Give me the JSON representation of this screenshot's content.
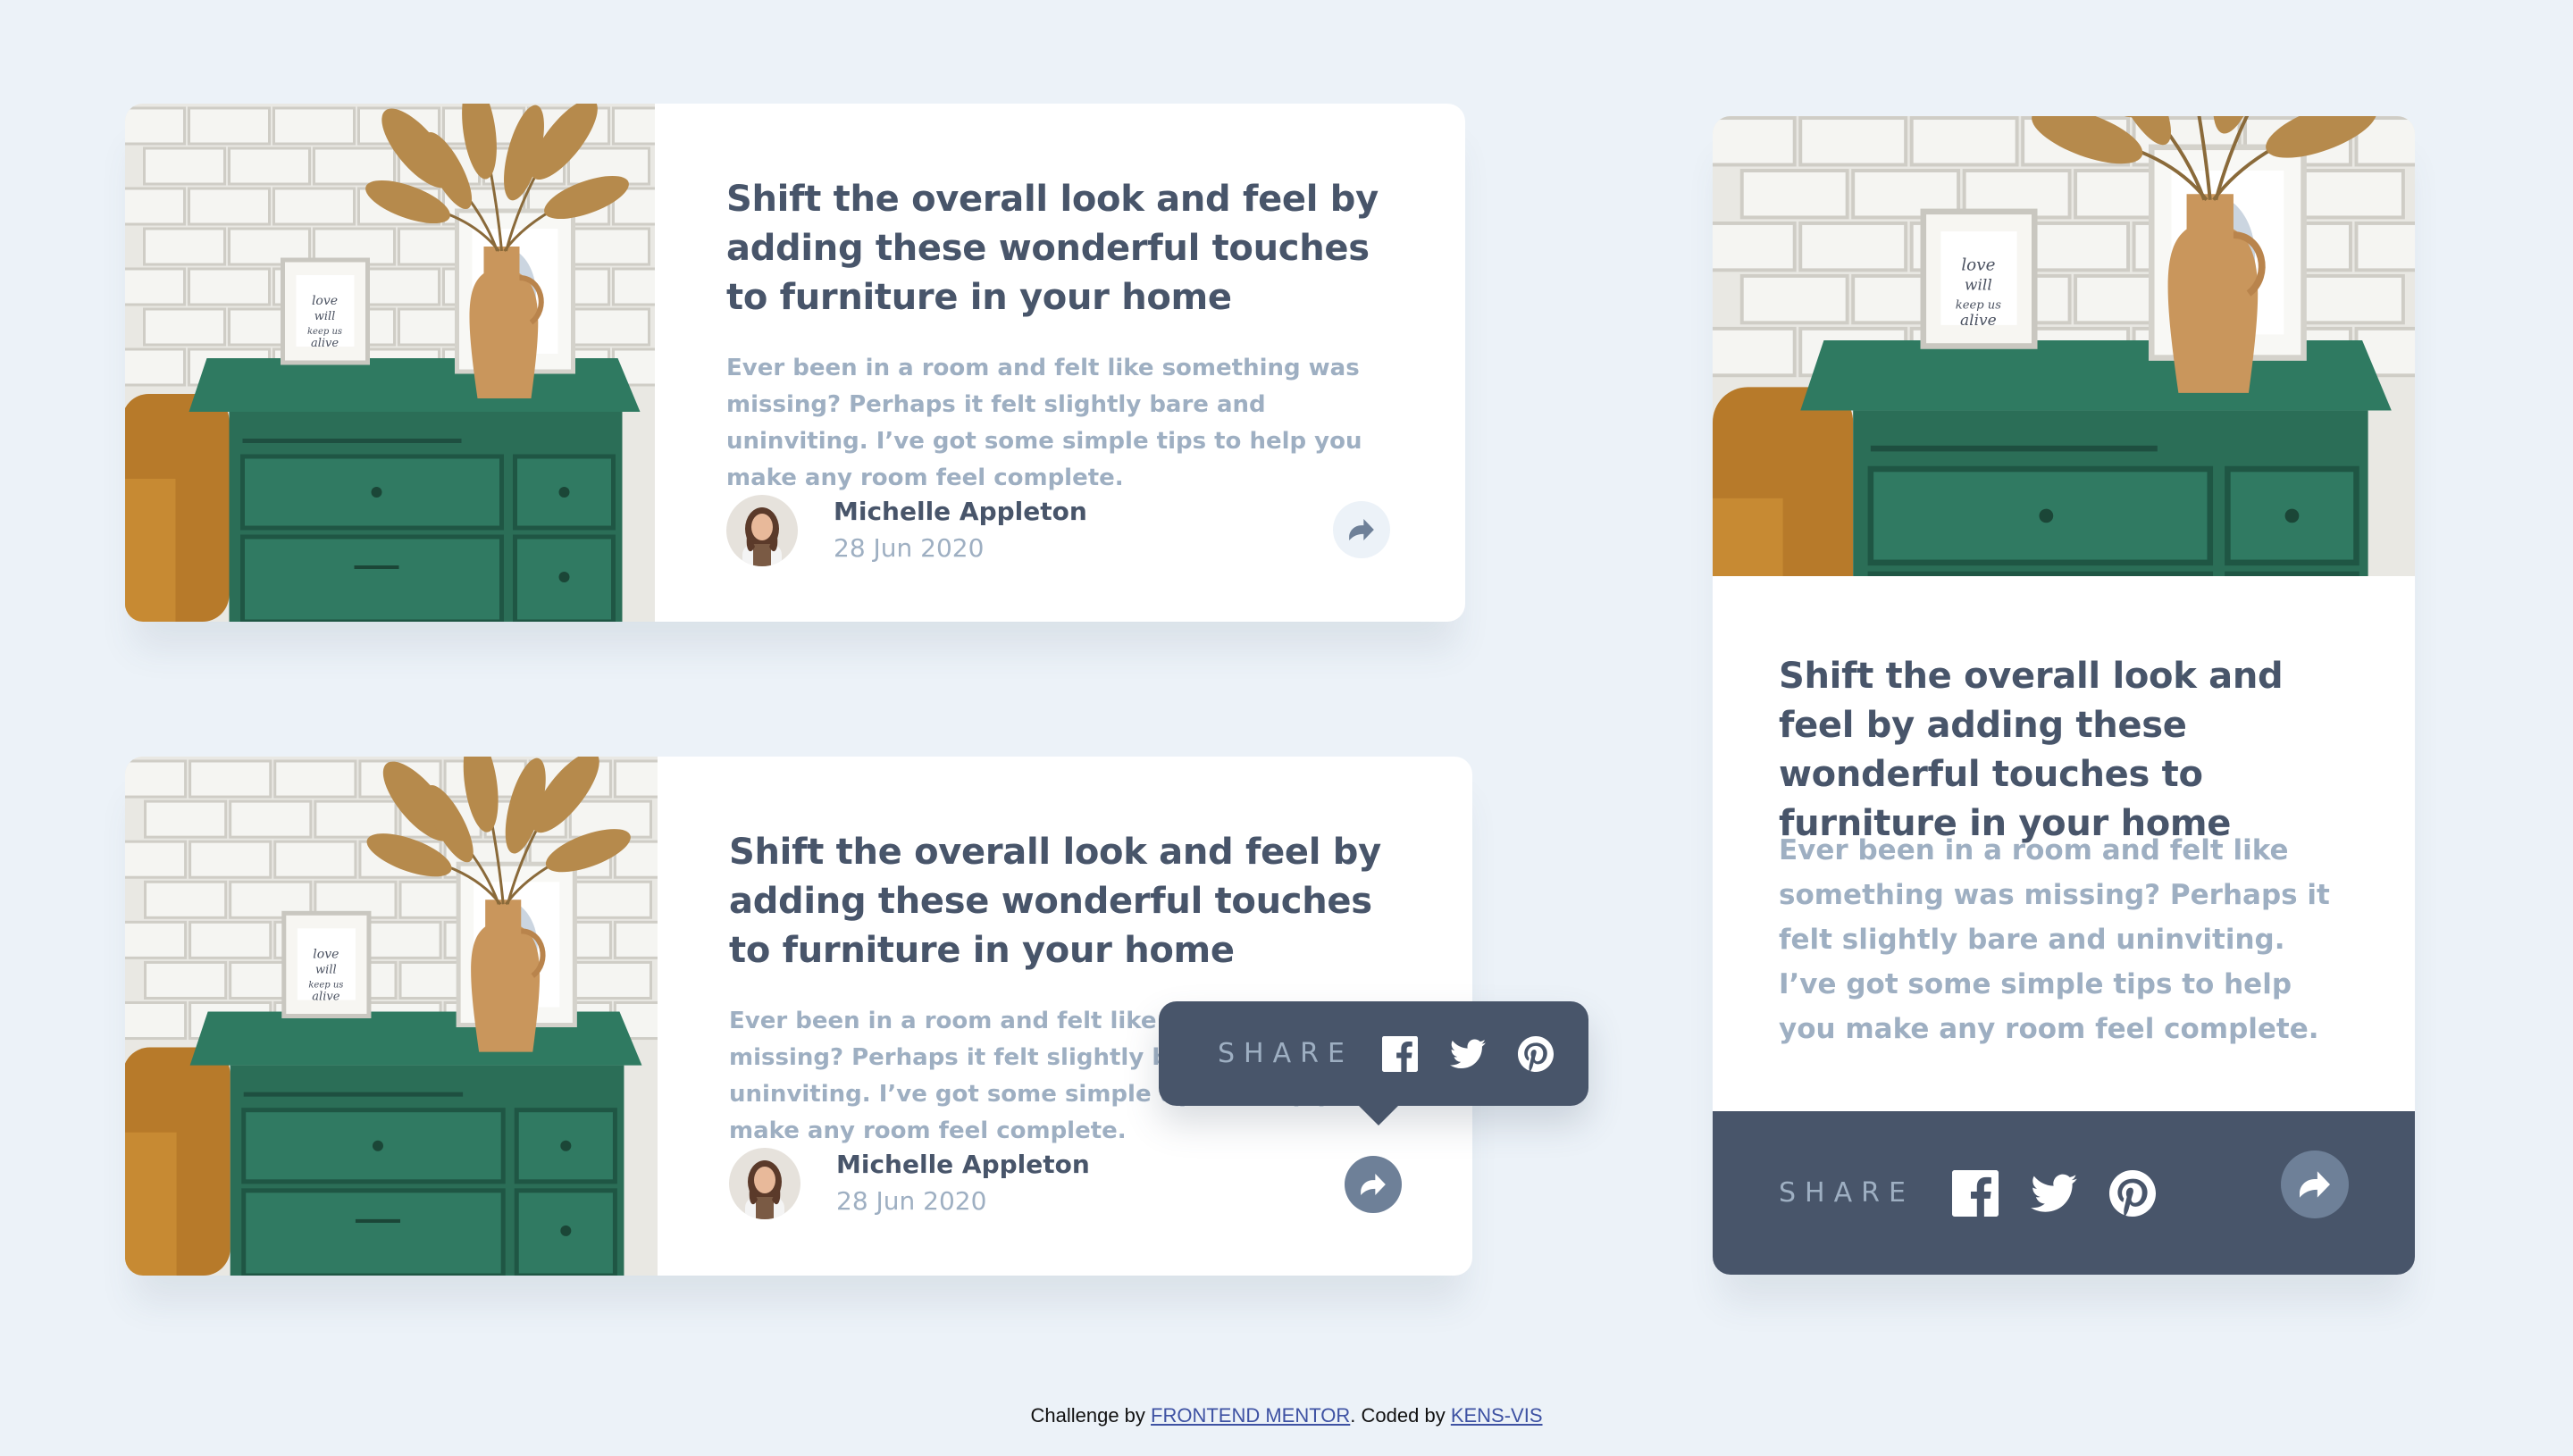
{
  "article": {
    "title": "Shift the overall look and feel by adding these wonderful touches to furniture in your home",
    "description": "Ever been in a room and felt like something was missing? Perhaps it felt slightly bare and uninviting. I’ve got some simple tips to help you make any room feel complete.",
    "author_name": "Michelle Appleton",
    "date": "28 Jun 2020",
    "image_alt": "Green drawer with vase",
    "photo_frame_text": "love will keep us alive"
  },
  "share": {
    "label": "SHARE",
    "icons": [
      "facebook-icon",
      "twitter-icon",
      "pinterest-icon"
    ],
    "button_icon": "share-arrow-icon"
  },
  "footer": {
    "prefix": "Challenge by ",
    "link1": "FRONTEND MENTOR",
    "middle": ". Coded by ",
    "link2": "KENS-VIS"
  },
  "colors": {
    "background": "#ecf2f8",
    "dark_blue": "#48556a",
    "grayish_blue": "#9eafc2",
    "desaturated_blue": "#6e8098",
    "light_blue": "#ecf2f8",
    "cabinet_green": "#2e7d64"
  }
}
